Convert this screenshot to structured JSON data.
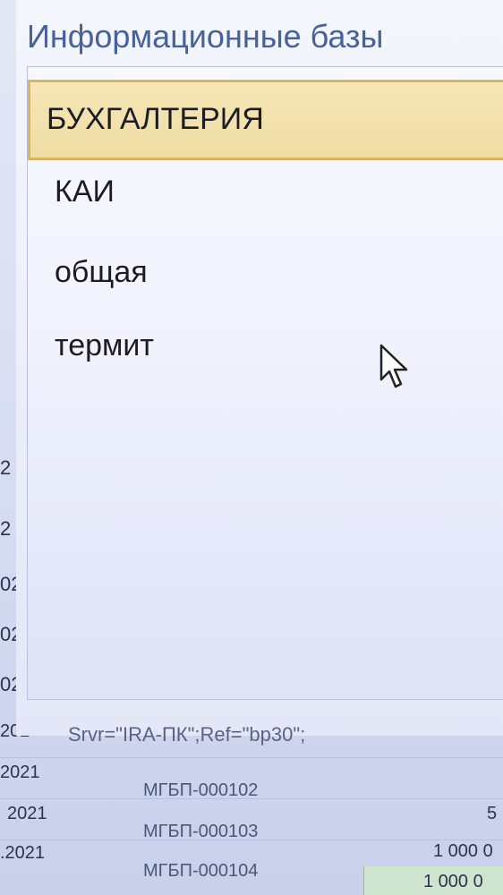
{
  "dialog": {
    "title": "Информационные базы",
    "items": [
      {
        "label": "БУХГАЛТЕРИЯ",
        "selected": true
      },
      {
        "label": "КАИ",
        "selected": false
      },
      {
        "label": "общая",
        "selected": false
      },
      {
        "label": "термит",
        "selected": false
      }
    ],
    "connection": "Srvr=\"IRA-ПК\";Ref=\"bp30\";"
  },
  "background_sheet": {
    "row_fragments": [
      "2",
      "2",
      "02",
      "02",
      "02",
      "202"
    ],
    "rows": [
      {
        "date": "2021",
        "code": "МГБП-000102",
        "amount": "5"
      },
      {
        "date": "2021",
        "code": "МГБП-000103",
        "amount": "1 000 0"
      },
      {
        "date": ".2021",
        "code": "МГБП-000104",
        "amount": "1 000 0"
      }
    ]
  },
  "colors": {
    "selected_bg": "#efdca3",
    "selected_border": "#d8b65e",
    "title_color": "#47619a"
  }
}
